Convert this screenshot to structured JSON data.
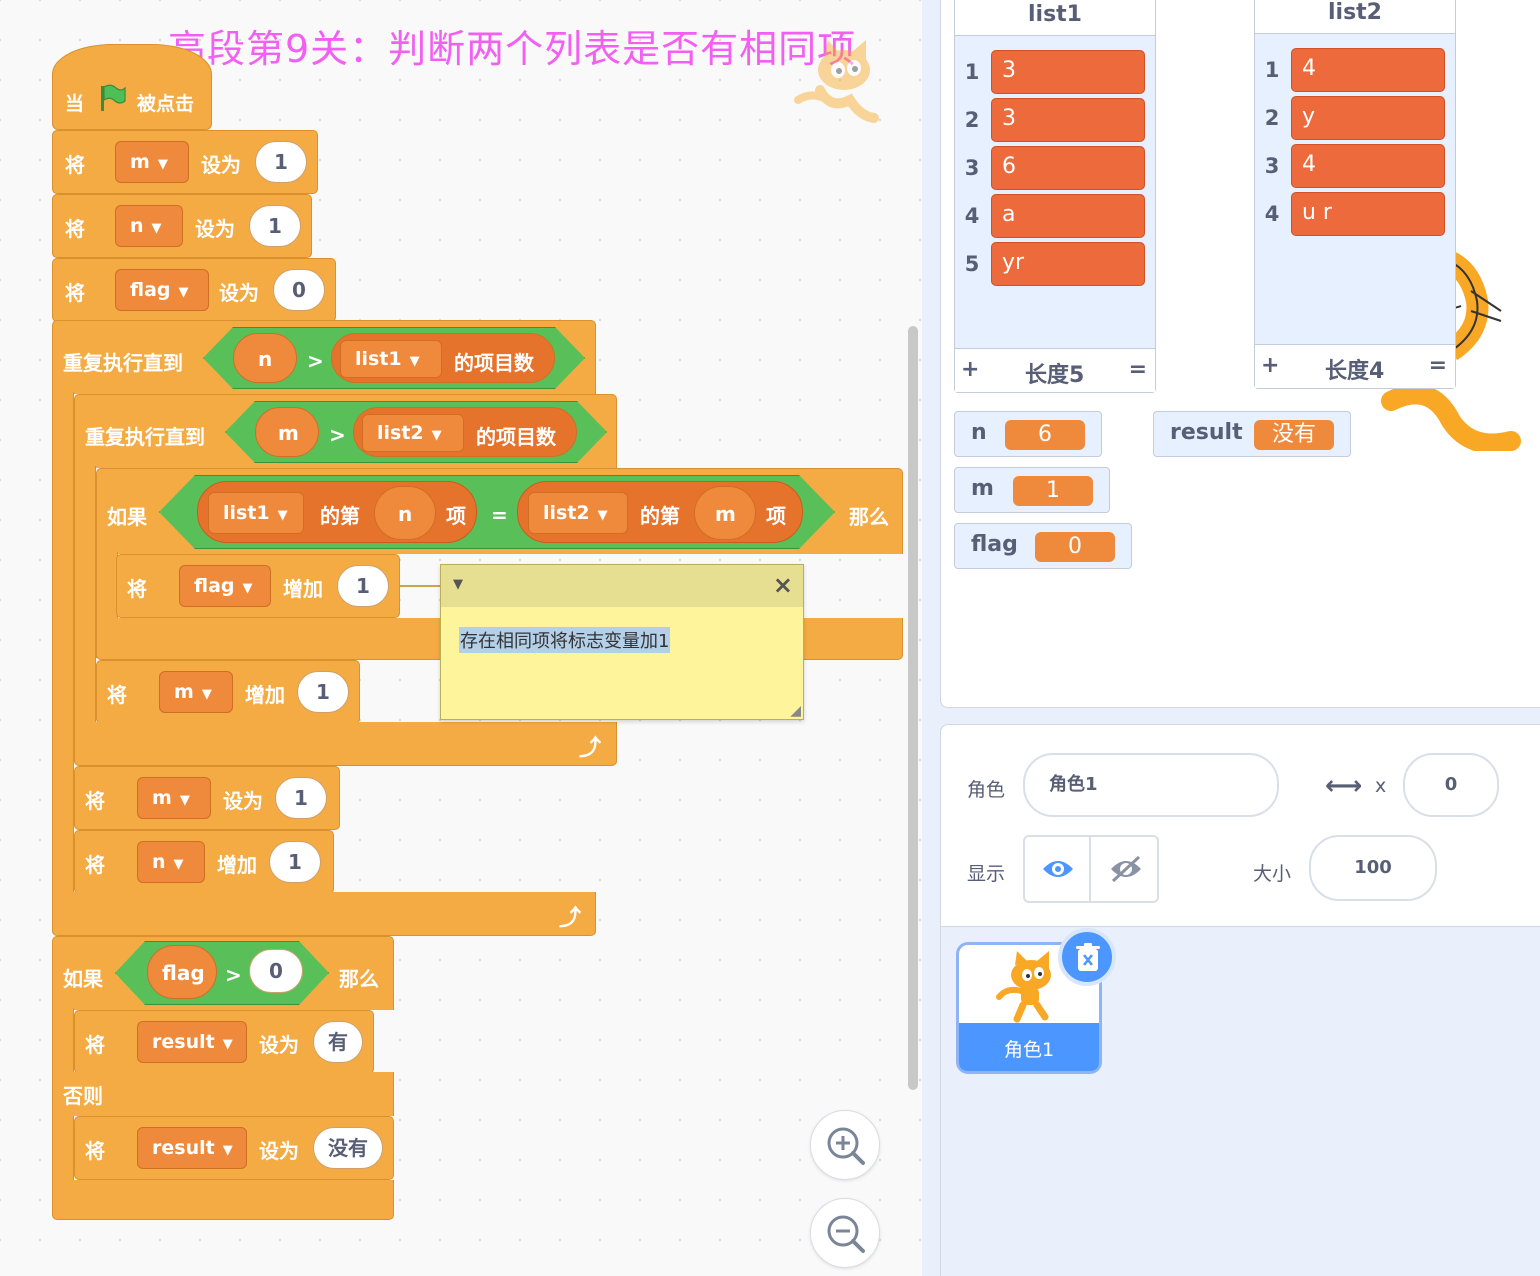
{
  "title": "高段第9关：判断两个列表是否有相同项",
  "script": {
    "hat": {
      "when": "当",
      "clicked": "被点击"
    },
    "set_m": {
      "verb": "将",
      "var": "m",
      "to": "设为",
      "value": "1"
    },
    "set_n": {
      "verb": "将",
      "var": "n",
      "to": "设为",
      "value": "1"
    },
    "set_flag": {
      "verb": "将",
      "var": "flag",
      "to": "设为",
      "value": "0"
    },
    "outer_loop": {
      "label": "重复执行直到",
      "left": "n",
      "op": ">",
      "list": "list1",
      "suffix": "的项目数"
    },
    "inner_loop": {
      "label": "重复执行直到",
      "left": "m",
      "op": ">",
      "list": "list2",
      "suffix": "的项目数"
    },
    "if_equal": {
      "if": "如果",
      "then": "那么",
      "list_a": "list1",
      "of_a": "的第",
      "idx_a": "n",
      "item_a": "项",
      "op": "=",
      "list_b": "list2",
      "of_b": "的第",
      "idx_b": "m",
      "item_b": "项"
    },
    "change_flag": {
      "verb": "将",
      "var": "flag",
      "by": "增加",
      "value": "1"
    },
    "change_m": {
      "verb": "将",
      "var": "m",
      "by": "增加",
      "value": "1"
    },
    "reset_m": {
      "verb": "将",
      "var": "m",
      "to": "设为",
      "value": "1"
    },
    "change_n": {
      "verb": "将",
      "var": "n",
      "by": "增加",
      "value": "1"
    },
    "if_flag": {
      "if": "如果",
      "var": "flag",
      "op": ">",
      "value": "0",
      "then": "那么"
    },
    "set_result_yes": {
      "verb": "将",
      "var": "result",
      "to": "设为",
      "value": "有"
    },
    "else": "否则",
    "set_result_no": {
      "verb": "将",
      "var": "result",
      "to": "设为",
      "value": "没有"
    }
  },
  "comment": {
    "text": "存在相同项将标志变量加1"
  },
  "stage": {
    "list1": {
      "name": "list1",
      "items": [
        "3",
        "3",
        "6",
        "a",
        "yr"
      ],
      "indices": [
        "1",
        "2",
        "3",
        "4",
        "5"
      ],
      "add": "+",
      "length": "长度5",
      "eq": "="
    },
    "list2": {
      "name": "list2",
      "items": [
        "4",
        "y",
        "4",
        "u r"
      ],
      "indices": [
        "1",
        "2",
        "3",
        "4"
      ],
      "add": "+",
      "length": "长度4",
      "eq": "="
    },
    "vars": {
      "n": {
        "name": "n",
        "value": "6"
      },
      "m": {
        "name": "m",
        "value": "1"
      },
      "flag": {
        "name": "flag",
        "value": "0"
      },
      "result": {
        "name": "result",
        "value": "没有"
      }
    }
  },
  "sprite_info": {
    "sprite_label": "角色",
    "sprite_name": "角色1",
    "x_label": "x",
    "x_value": "0",
    "show_label": "显示",
    "size_label": "大小",
    "size_value": "100"
  },
  "sprite_list": [
    {
      "name": "角色1"
    }
  ],
  "colors": {
    "motion_orange": "#f4ab43",
    "variable_orange": "#ef8a3d",
    "operator_green": "#59c059",
    "list_red": "#ec6a3c",
    "title_pink": "#f25ff2"
  }
}
